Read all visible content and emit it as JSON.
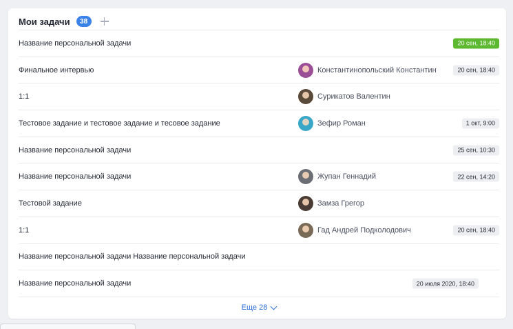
{
  "header": {
    "title": "Мои задачи",
    "count": "38",
    "add_icon": "plus-icon"
  },
  "colors": {
    "count_badge": "#3b82e8",
    "date_green": "#5cb82e",
    "link": "#2f6fd6"
  },
  "tasks": [
    {
      "name": "Название персональной задачи",
      "assignee": "",
      "date": "20 сен, 18:40",
      "date_style": "green"
    },
    {
      "name": "Финальное интервью",
      "assignee": "Константинопольский Константин",
      "date": "20 сен, 18:40",
      "date_style": "gray"
    },
    {
      "name": "1:1",
      "assignee": "Сурикатов Валентин",
      "date": "",
      "date_style": "gray"
    },
    {
      "name": "Тестовое задание и тестовое задание и тесовое задание",
      "assignee": "Зефир Роман",
      "date": "1 окт, 9:00",
      "date_style": "gray"
    },
    {
      "name": "Название персональной задачи",
      "assignee": "",
      "date": "25 сен, 10:30",
      "date_style": "gray"
    },
    {
      "name": "Название персональной задачи",
      "assignee": "Жупан Геннадий",
      "date": "22 сен, 14:20",
      "date_style": "gray"
    },
    {
      "name": "Тестовой задание",
      "assignee": "Замза Грегор",
      "date": "",
      "date_style": "gray"
    },
    {
      "name": "1:1",
      "assignee": "Гад Андрей Подколодович",
      "date": "20 сен, 18:40",
      "date_style": "gray"
    },
    {
      "name": "Название персональной задачи Название персональной задачи",
      "assignee": "",
      "date": "",
      "date_style": "gray"
    },
    {
      "name": "Название персональной задачи",
      "assignee": "",
      "date": "20 июля 2020, 18:40",
      "date_style": "gray"
    }
  ],
  "footer": {
    "more_label": "Еще 28",
    "more_icon": "chevron-down-icon"
  }
}
